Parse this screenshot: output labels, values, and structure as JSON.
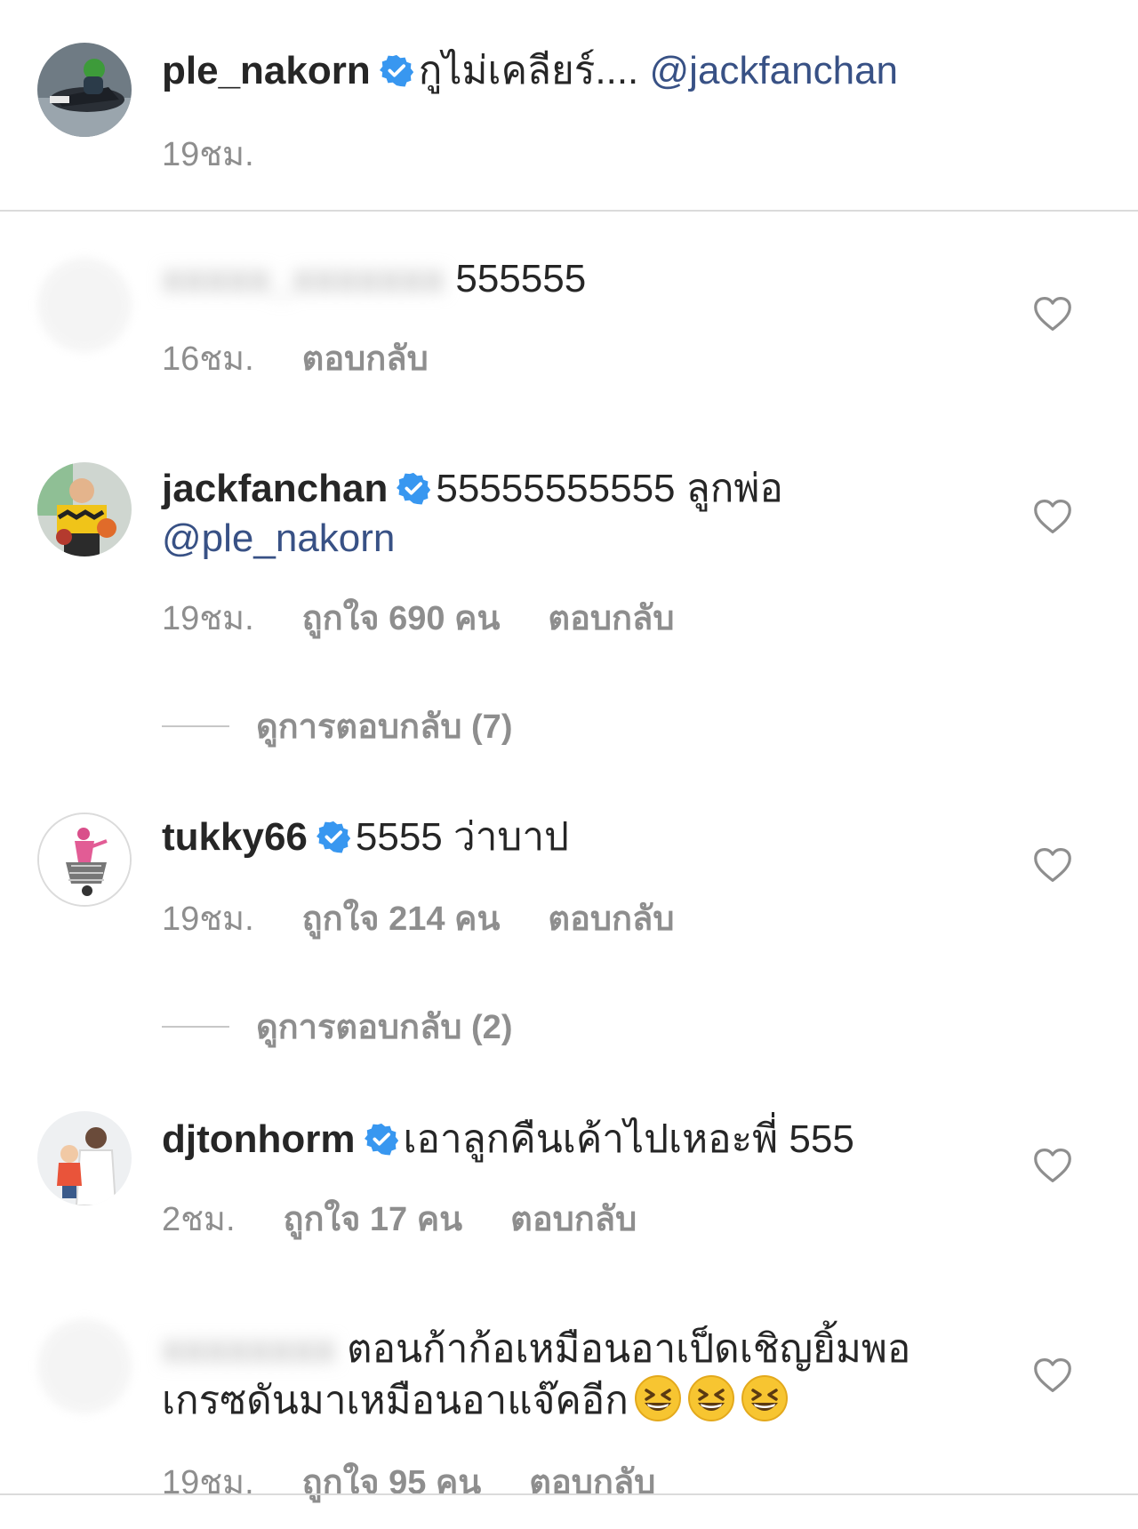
{
  "caption": {
    "username": "ple_nakorn",
    "text": "กูไม่เคลียร์....",
    "mention": "@jackfanchan",
    "time": "19ชม."
  },
  "comments": [
    {
      "username_blurred": "xxxxx_xxxxxxx",
      "text": "555555",
      "time": "16ชม.",
      "reply": "ตอบกลับ"
    },
    {
      "username": "jackfanchan",
      "text": "55555555555 ลูกพ่อ",
      "mention": "@ple_nakorn",
      "time": "19ชม.",
      "likes": "ถูกใจ 690 คน",
      "reply": "ตอบกลับ",
      "view_replies": "ดูการตอบกลับ (7)"
    },
    {
      "username": "tukky66",
      "text": "5555 ว่าบาป",
      "time": "19ชม.",
      "likes": "ถูกใจ 214 คน",
      "reply": "ตอบกลับ",
      "view_replies": "ดูการตอบกลับ (2)"
    },
    {
      "username": "djtonhorm",
      "text": "เอาลูกคืนเค้าไปเหอะพี่ 555",
      "time": "2ชม.",
      "likes": "ถูกใจ 17 คน",
      "reply": "ตอบกลับ"
    },
    {
      "username_blurred": "xxxxxxxx",
      "text": "ตอนก้าก้อเหมือนอาเป็ดเชิญยิ้มพอเกรซดันมาเหมือนอาแจ๊คอีก",
      "emoji": [
        "grinning-squinting-face",
        "grinning-squinting-face",
        "grinning-squinting-face"
      ],
      "time": "19ชม.",
      "likes": "ถูกใจ 95 คน",
      "reply": "ตอบกลับ"
    }
  ],
  "icons": {
    "verified": "verified-badge-icon",
    "like": "heart-outline-icon"
  },
  "colors": {
    "verified": "#3897f0",
    "mention": "#385185",
    "meta": "#8e8e8e",
    "text": "#262626",
    "divider": "#dbdbdb"
  }
}
